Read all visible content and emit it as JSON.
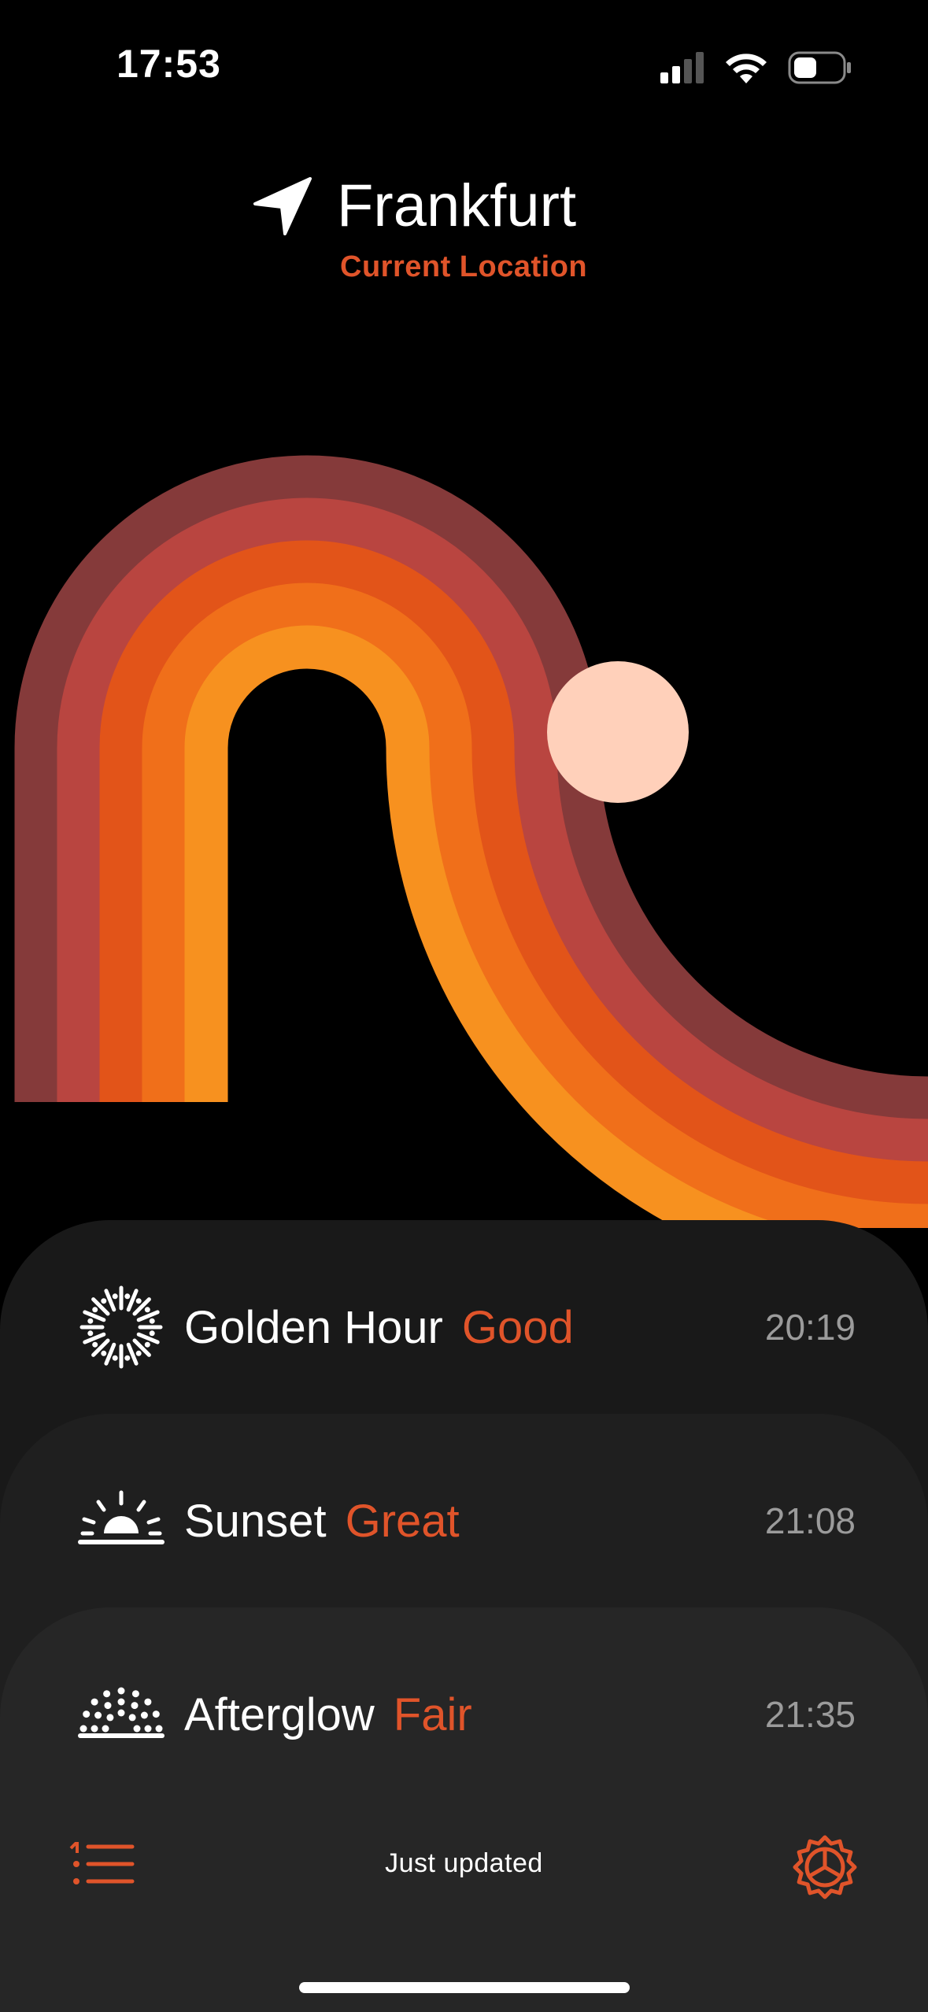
{
  "status_bar": {
    "time": "17:53"
  },
  "header": {
    "city": "Frankfurt",
    "subtitle": "Current Location"
  },
  "sun_arc": {
    "band_colors": [
      "#853a3a",
      "#b94540",
      "#e25419",
      "#f06f1a",
      "#f7911f"
    ],
    "sun_color": "#ffd0ba"
  },
  "events": [
    {
      "name": "Golden Hour",
      "rating": "Good",
      "time": "20:19",
      "icon": "golden-hour-icon"
    },
    {
      "name": "Sunset",
      "rating": "Great",
      "time": "21:08",
      "icon": "sunset-icon"
    },
    {
      "name": "Afterglow",
      "rating": "Fair",
      "time": "21:35",
      "icon": "afterglow-icon"
    }
  ],
  "footer": {
    "status": "Just updated",
    "left_icon": "list-icon",
    "right_icon": "settings-icon"
  },
  "colors": {
    "accent": "#e0542a",
    "background": "#000000"
  }
}
